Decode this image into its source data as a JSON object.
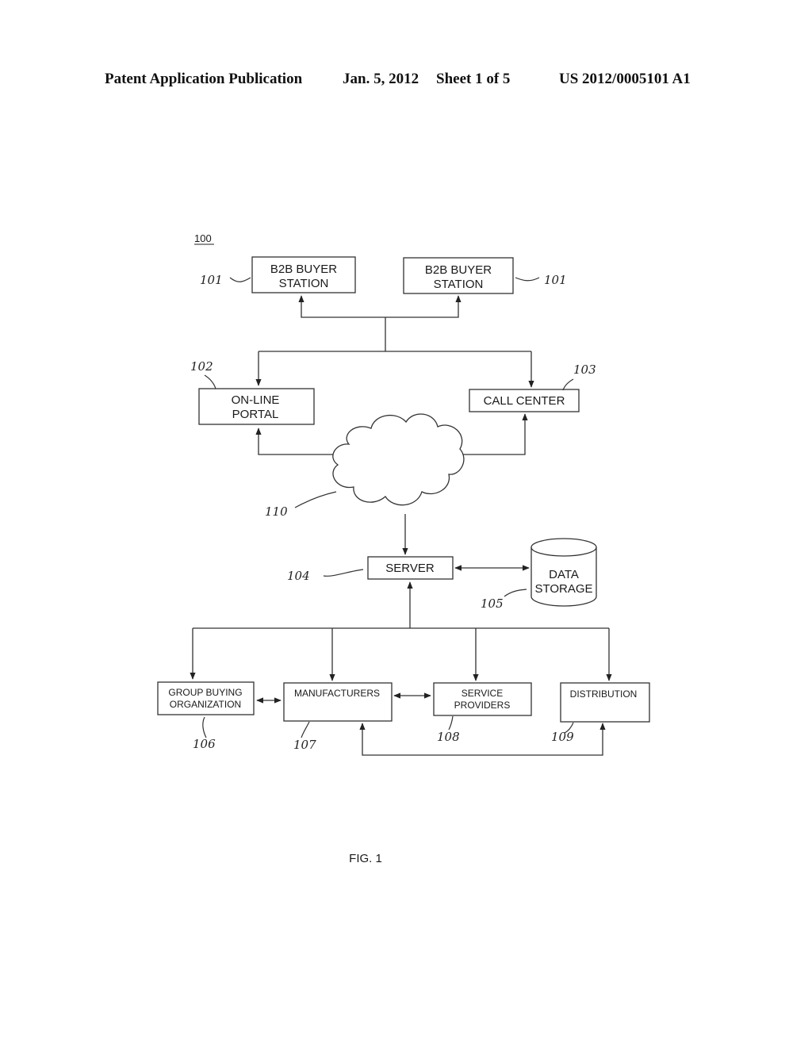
{
  "header": {
    "publication": "Patent Application Publication",
    "date": "Jan. 5, 2012",
    "sheet": "Sheet 1 of 5",
    "number": "US 2012/0005101 A1"
  },
  "figure": {
    "system_ref": "100",
    "caption": "FIG. 1",
    "nodes": {
      "buyer_left": {
        "lines": [
          "B2B BUYER",
          "STATION"
        ],
        "ref": "101"
      },
      "buyer_right": {
        "lines": [
          "B2B BUYER",
          "STATION"
        ],
        "ref": "101"
      },
      "portal": {
        "lines": [
          "ON-LINE",
          "PORTAL"
        ],
        "ref": "102"
      },
      "call_center": {
        "lines": [
          "CALL CENTER"
        ],
        "ref": "103"
      },
      "network": {
        "ref": "110"
      },
      "server": {
        "lines": [
          "SERVER"
        ],
        "ref": "104"
      },
      "storage": {
        "lines": [
          "DATA",
          "STORAGE"
        ],
        "ref": "105"
      },
      "gpo": {
        "lines": [
          "GROUP BUYING",
          "ORGANIZATION"
        ],
        "ref": "106"
      },
      "manufacturers": {
        "lines": [
          "MANUFACTURERS"
        ],
        "ref": "107"
      },
      "services": {
        "lines": [
          "SERVICE",
          "PROVIDERS"
        ],
        "ref": "108"
      },
      "distribution": {
        "lines": [
          "DISTRIBUTION"
        ],
        "ref": "109"
      }
    }
  }
}
